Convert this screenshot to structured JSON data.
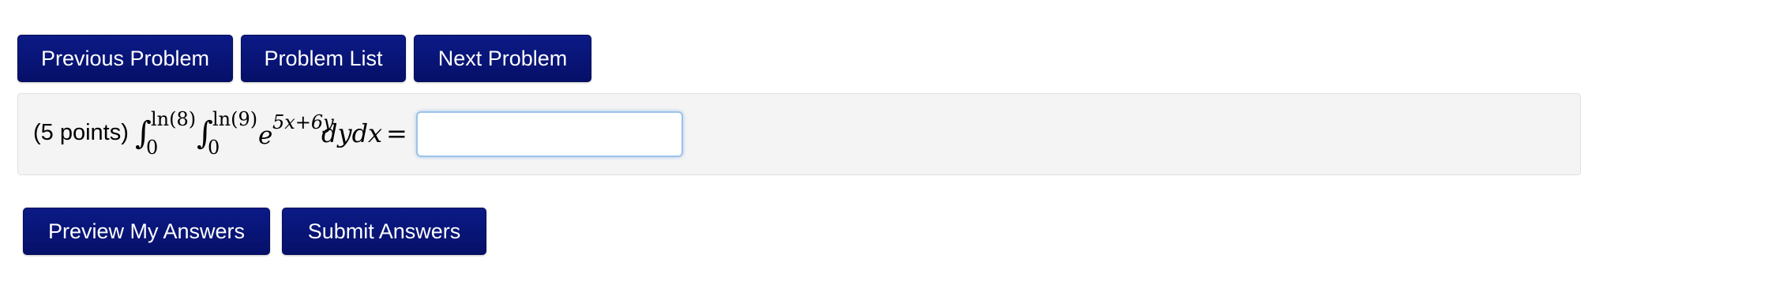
{
  "nav": {
    "previous_label": "Previous Problem",
    "list_label": "Problem List",
    "next_label": "Next Problem"
  },
  "problem": {
    "points_label": "(5 points)",
    "outer_integral": {
      "upper": "ln(8)",
      "lower": "0"
    },
    "inner_integral": {
      "upper": "ln(9)",
      "lower": "0"
    },
    "integrand_base": "e",
    "integrand_exponent": "5x+6y",
    "differentials": "dydx",
    "equals": "=",
    "answer_value": ""
  },
  "actions": {
    "preview_label": "Preview My Answers",
    "submit_label": "Submit Answers"
  },
  "colors": {
    "button_bg": "#0b1a86",
    "button_text": "#ffffff",
    "panel_bg": "#f4f4f4",
    "input_focus_border": "#9cc3ea"
  }
}
